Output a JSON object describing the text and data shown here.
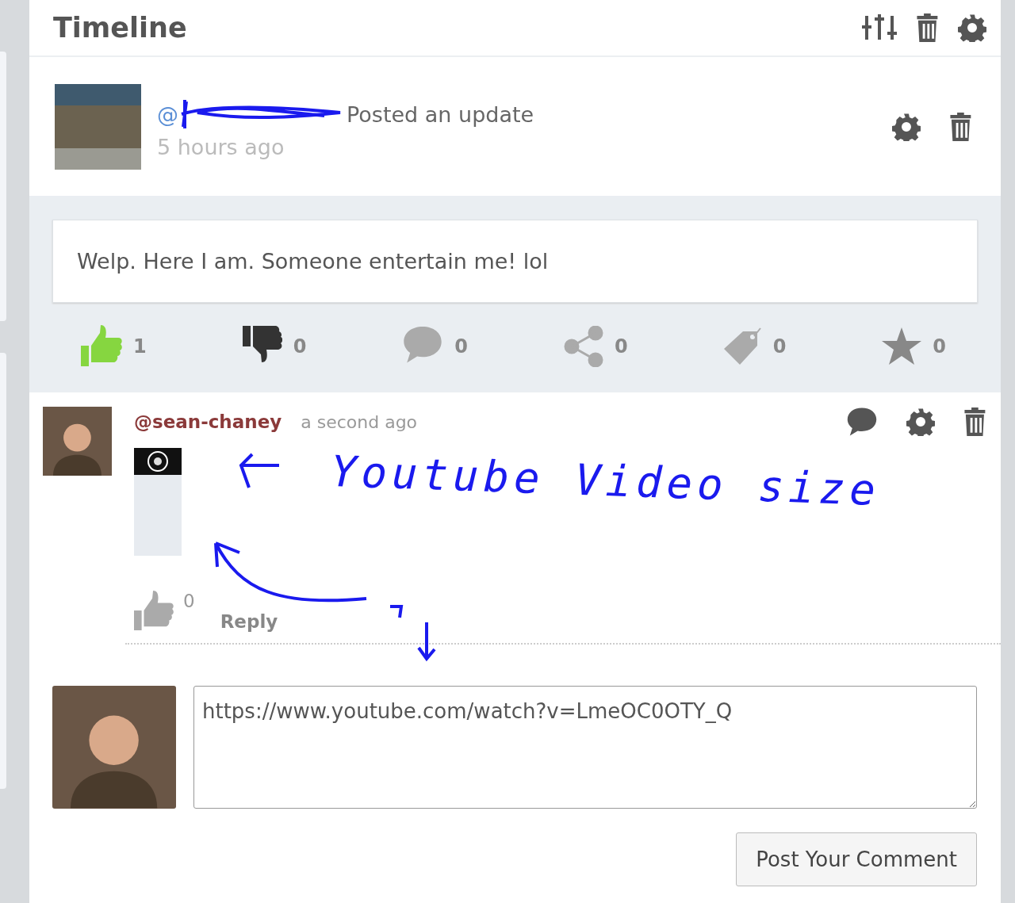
{
  "panel": {
    "title": "Timeline"
  },
  "post": {
    "author_prefix": "@",
    "action": "Posted an update",
    "time": "5 hours ago",
    "body": "Welp. Here I am. Someone entertain me! lol"
  },
  "reactions": [
    {
      "kind": "like",
      "count": "1",
      "selected": true
    },
    {
      "kind": "dislike",
      "count": "0",
      "selected": false
    },
    {
      "kind": "comment",
      "count": "0",
      "selected": false
    },
    {
      "kind": "share",
      "count": "0",
      "selected": false
    },
    {
      "kind": "tag",
      "count": "0",
      "selected": false
    },
    {
      "kind": "star",
      "count": "0",
      "selected": false
    }
  ],
  "comment": {
    "author": "@sean-chaney",
    "time": "a second ago",
    "likes": "0",
    "reply": "Reply"
  },
  "annotation": {
    "text": "Youtube Video size"
  },
  "composer": {
    "value": "https://www.youtube.com/watch?v=LmeOC0OTY_Q",
    "button": "Post Your Comment"
  }
}
